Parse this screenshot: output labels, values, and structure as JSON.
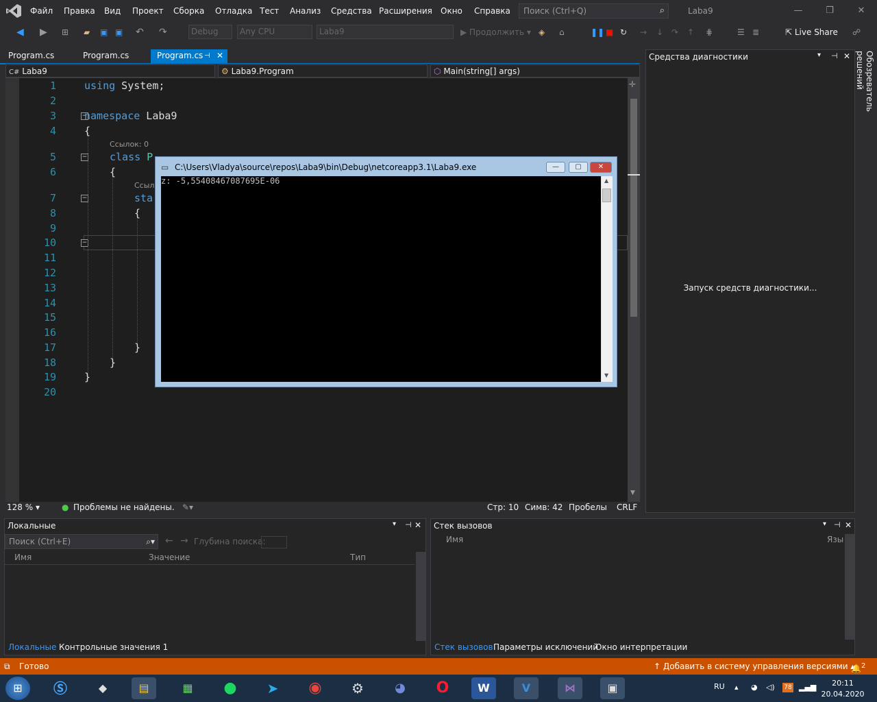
{
  "menu": {
    "items": [
      "Файл",
      "Правка",
      "Вид",
      "Проект",
      "Сборка",
      "Отладка",
      "Тест",
      "Анализ",
      "Средства",
      "Расширения",
      "Окно",
      "Справка"
    ],
    "search_placeholder": "Поиск (Ctrl+Q)",
    "solution_name": "Laba9"
  },
  "toolbar": {
    "config": "Debug",
    "platform": "Any CPU",
    "project": "Laba9",
    "continue_label": "Продолжить",
    "live_share": "Live Share"
  },
  "tabs": [
    {
      "label": "Program.cs",
      "active": false
    },
    {
      "label": "Program.cs",
      "active": false
    },
    {
      "label": "Program.cs",
      "active": true
    }
  ],
  "nav": {
    "project": "Laba9",
    "type": "Laba9.Program",
    "member": "Main(string[] args)"
  },
  "editor": {
    "line_numbers": [
      "1",
      "2",
      "3",
      "4",
      "5",
      "6",
      "7",
      "8",
      "9",
      "10",
      "11",
      "12",
      "13",
      "14",
      "15",
      "16",
      "17",
      "18",
      "19",
      "20"
    ],
    "line1_kw": "using",
    "line1_rest": " System;",
    "line3_kw": "namespace",
    "line3_rest": " Laba9",
    "brace_open": "{",
    "brace_close": "}",
    "class_kw": "class",
    "class_rest": " P",
    "static_kw": "sta",
    "refs_hint_0": "Ссылок: 0",
    "refs_hint_1": "Ссыл"
  },
  "editor_status": {
    "zoom": "128 %",
    "issues": "Проблемы не найдены.",
    "line": "Стр: 10",
    "col": "Симв: 42",
    "spaces": "Пробелы",
    "eol": "CRLF"
  },
  "console": {
    "title": "C:\\Users\\Vladya\\source\\repos\\Laba9\\bin\\Debug\\netcoreapp3.1\\Laba9.exe",
    "output": "z: -5,55408467087695E-06"
  },
  "diagnostics": {
    "title": "Средства диагностики",
    "message": "Запуск средств диагностики..."
  },
  "solution_explorer_tab": "Обозреватель решений",
  "locals": {
    "title": "Локальные",
    "search_placeholder": "Поиск (Ctrl+E)",
    "depth_label": "Глубина поиска:",
    "columns": [
      "Имя",
      "Значение",
      "Тип"
    ],
    "tabs": [
      "Локальные",
      "Контрольные значения 1"
    ]
  },
  "callstack": {
    "title": "Стек вызовов",
    "columns": [
      "Имя",
      "Язык"
    ],
    "tabs": [
      "Стек вызовов",
      "Параметры исключений",
      "Окно интерпретации"
    ]
  },
  "statusbar": {
    "ready": "Готово",
    "source_control": "Добавить в систему управления версиями",
    "notifications": "2"
  },
  "taskbar": {
    "lang": "RU",
    "battery": "78",
    "time": "20:11",
    "date": "20.04.2020"
  },
  "colors": {
    "accent": "#007acc",
    "status_bar": "#ca5100",
    "keyword": "#569cd6",
    "line_number": "#2b91af"
  }
}
